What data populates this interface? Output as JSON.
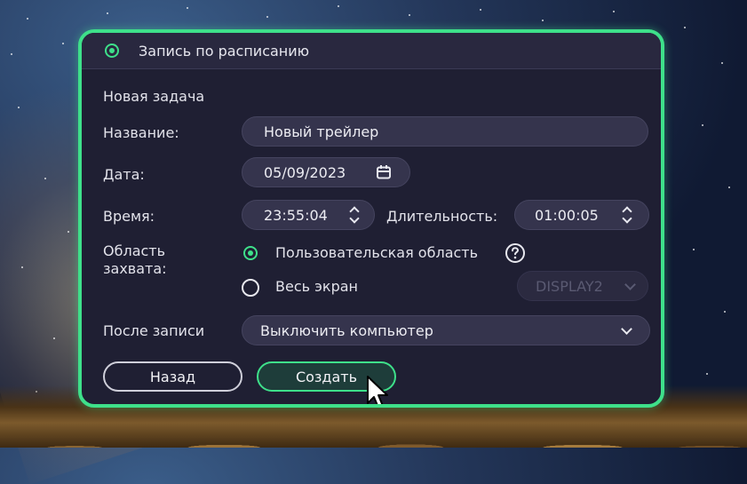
{
  "dialog": {
    "title": "Запись по расписанию",
    "section": "Новая задача",
    "name_label": "Название:",
    "name_value": "Новый трейлер",
    "date_label": "Дата:",
    "date_value": "05/09/2023",
    "time_label": "Время:",
    "time_value": "23:55:04",
    "duration_label": "Длительность:",
    "duration_value": "01:00:05",
    "capture_label_line1": "Область",
    "capture_label_line2": "захвата:",
    "capture_options": [
      {
        "label": "Пользовательская область",
        "selected": true
      },
      {
        "label": "Весь экран",
        "selected": false
      }
    ],
    "display_select": "DISPLAY2",
    "after_label": "После записи",
    "after_value": "Выключить компьютер",
    "back_button": "Назад",
    "create_button": "Создать"
  },
  "colors": {
    "accent": "#3ee08a",
    "dialog_bg": "#1f1f33",
    "field_bg": "#35344d"
  },
  "icons": [
    "radio-selected-icon",
    "calendar-icon",
    "spinner-icon",
    "help-icon",
    "chevron-down-icon",
    "mouse-cursor-icon"
  ]
}
